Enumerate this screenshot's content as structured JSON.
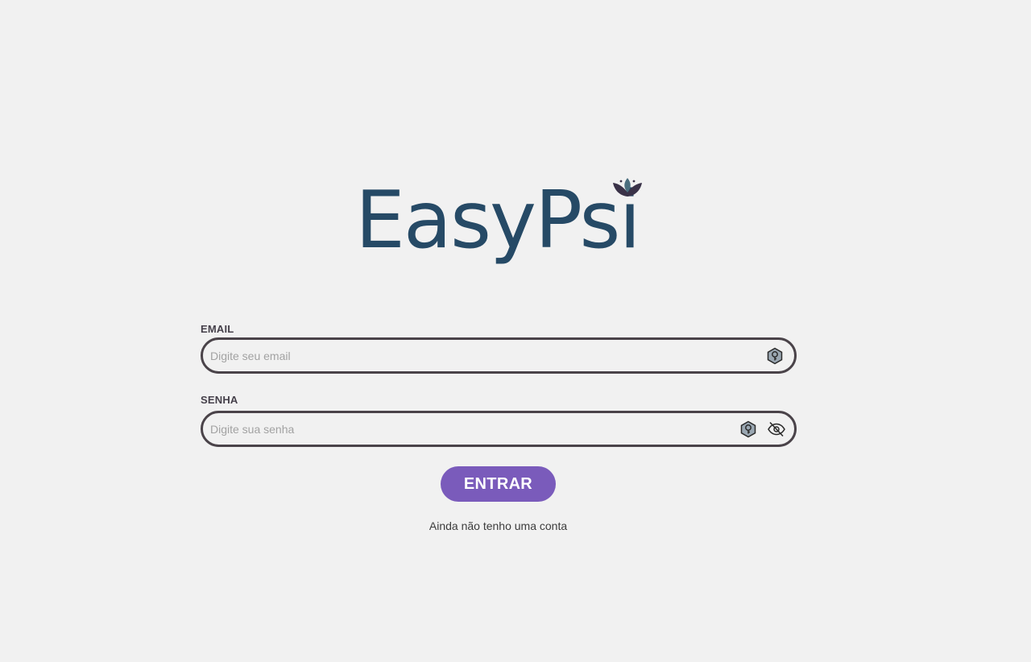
{
  "brand": {
    "name": "EasyPsi",
    "logo_color": "#264a66",
    "lotus_colors": [
      "#3a3248",
      "#4a6e7e"
    ]
  },
  "form": {
    "email": {
      "label": "EMAIL",
      "value": "",
      "placeholder": "Digite seu email",
      "icon": "key-icon"
    },
    "password": {
      "label": "SENHA",
      "value": "",
      "placeholder": "Digite sua senha",
      "icons": [
        "key-icon",
        "eye-off-icon"
      ]
    },
    "submit_label": "ENTRAR",
    "signup_link": "Ainda não tenho uma conta"
  },
  "colors": {
    "background": "#f1f1f1",
    "input_border": "#4a4349",
    "button": "#7a5bbb",
    "label": "#45404a"
  }
}
